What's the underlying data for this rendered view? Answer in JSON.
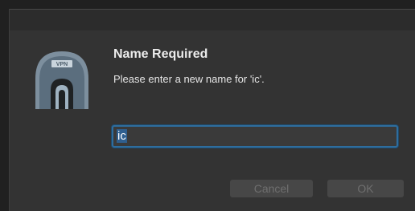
{
  "dialog": {
    "title": "Name Required",
    "message": "Please enter a new name for 'ic'.",
    "icon": "vpn-tunnel-icon",
    "icon_badge": "VPN",
    "input": {
      "value": "ic"
    },
    "buttons": {
      "cancel": "Cancel",
      "ok": "OK"
    }
  },
  "colors": {
    "dialog_background": "#333333",
    "focus_ring": "#2e6d9e",
    "button_disabled_text": "#6f6f6f"
  }
}
